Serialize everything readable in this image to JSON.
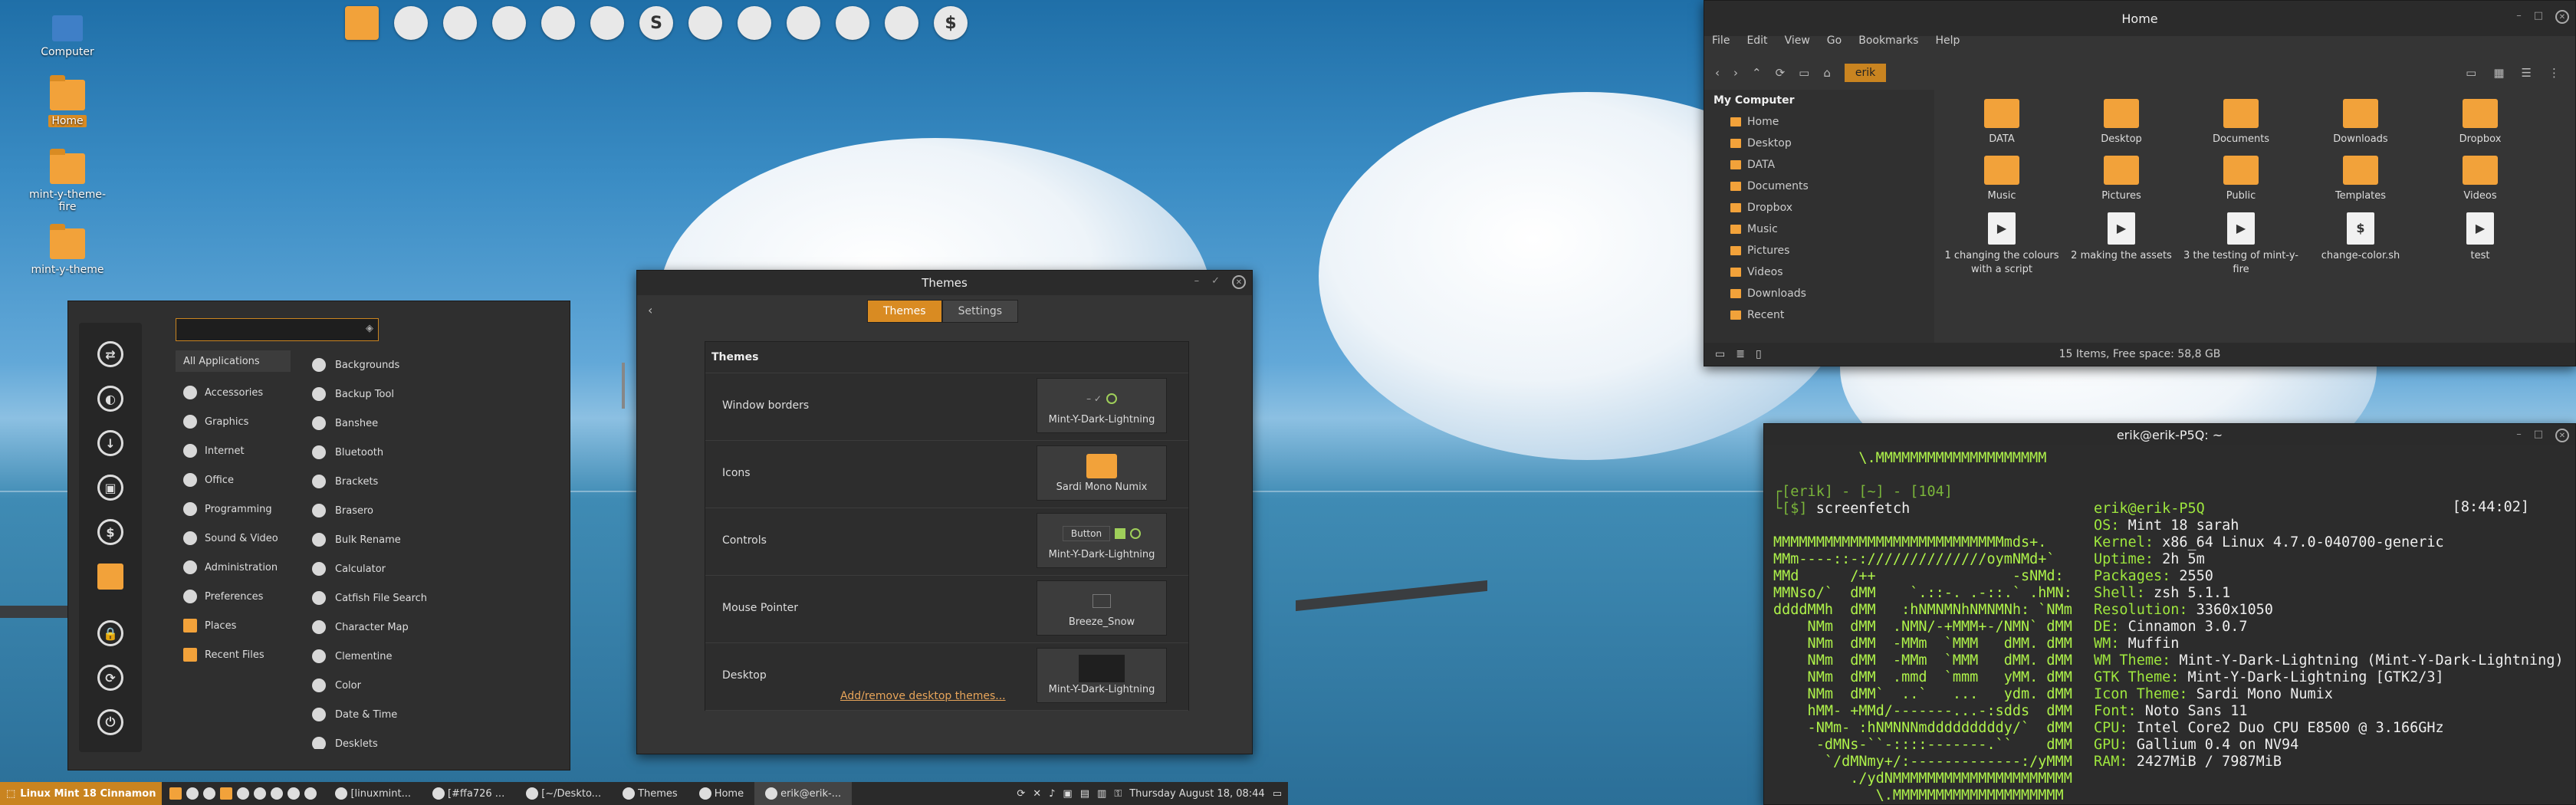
{
  "desktop": {
    "icons": [
      {
        "label": "Computer",
        "icon": "computer-icon"
      },
      {
        "label": "Home",
        "icon": "folder-home-icon"
      },
      {
        "label": "mint-y-theme-fire",
        "icon": "folder-icon"
      },
      {
        "label": "mint-y-theme",
        "icon": "folder-icon"
      }
    ],
    "top_launchers": [
      "folder",
      "redshift",
      "files",
      "spotify",
      "teapot",
      "weather",
      "S",
      "settings",
      "ninja",
      "brackets",
      "photos",
      "switch",
      "$"
    ]
  },
  "menu": {
    "search_placeholder": "",
    "categories": [
      "All Applications",
      "Accessories",
      "Graphics",
      "Internet",
      "Office",
      "Programming",
      "Sound & Video",
      "Administration",
      "Preferences",
      "Places",
      "Recent Files"
    ],
    "apps": [
      "Backgrounds",
      "Backup Tool",
      "Banshee",
      "Bluetooth",
      "Brackets",
      "Brasero",
      "Bulk Rename",
      "Calculator",
      "Catfish File Search",
      "Character Map",
      "Clementine",
      "Color",
      "Date & Time",
      "Desklets"
    ]
  },
  "themes_window": {
    "title": "Themes",
    "tabs": [
      "Themes",
      "Settings"
    ],
    "section": "Themes",
    "rows": [
      {
        "label": "Window borders",
        "value": "Mint-Y-Dark-Lightning"
      },
      {
        "label": "Icons",
        "value": "Sardi Mono Numix"
      },
      {
        "label": "Controls",
        "value": "Mint-Y-Dark-Lightning",
        "preview_button": "Button"
      },
      {
        "label": "Mouse Pointer",
        "value": "Breeze_Snow"
      },
      {
        "label": "Desktop",
        "value": "Mint-Y-Dark-Lightning"
      }
    ],
    "link": "Add/remove desktop themes..."
  },
  "file_manager": {
    "title": "Home",
    "menus": [
      "File",
      "Edit",
      "View",
      "Go",
      "Bookmarks",
      "Help"
    ],
    "crumb": "erik",
    "side_header": "My Computer",
    "side": [
      "Home",
      "Desktop",
      "DATA",
      "Documents",
      "Dropbox",
      "Music",
      "Pictures",
      "Videos",
      "Downloads",
      "Recent"
    ],
    "items": [
      {
        "label": "DATA",
        "kind": "folder"
      },
      {
        "label": "Desktop",
        "kind": "folder"
      },
      {
        "label": "Documents",
        "kind": "folder"
      },
      {
        "label": "Downloads",
        "kind": "folder"
      },
      {
        "label": "Dropbox",
        "kind": "folder"
      },
      {
        "label": "Music",
        "kind": "folder"
      },
      {
        "label": "Pictures",
        "kind": "folder"
      },
      {
        "label": "Public",
        "kind": "folder"
      },
      {
        "label": "Templates",
        "kind": "folder"
      },
      {
        "label": "Videos",
        "kind": "folder"
      },
      {
        "label": "1 changing the colours with a script",
        "kind": "file"
      },
      {
        "label": "2 making the assets",
        "kind": "file"
      },
      {
        "label": "3 the testing of mint-y-fire",
        "kind": "file"
      },
      {
        "label": "change-color.sh",
        "kind": "script"
      },
      {
        "label": "test",
        "kind": "file"
      }
    ],
    "status": "15 Items, Free space: 58,8 GB"
  },
  "terminal": {
    "title": "erik@erik-P5Q: ~",
    "prompt_user": "erik",
    "prompt_rest": "- [~] - [104]",
    "command": "screenfetch",
    "clock": "[8:44:02]",
    "userhost": "erik@erik-P5Q",
    "info": [
      {
        "k": "OS:",
        "v": "Mint 18 sarah"
      },
      {
        "k": "Kernel:",
        "v": "x86_64 Linux 4.7.0-040700-generic"
      },
      {
        "k": "Uptime:",
        "v": "2h 5m"
      },
      {
        "k": "Packages:",
        "v": "2550"
      },
      {
        "k": "Shell:",
        "v": "zsh 5.1.1"
      },
      {
        "k": "Resolution:",
        "v": "3360x1050"
      },
      {
        "k": "DE:",
        "v": "Cinnamon 3.0.7"
      },
      {
        "k": "WM:",
        "v": "Muffin"
      },
      {
        "k": "WM Theme:",
        "v": "Mint-Y-Dark-Lightning (Mint-Y-Dark-Lightning)"
      },
      {
        "k": "GTK Theme:",
        "v": "Mint-Y-Dark-Lightning [GTK2/3]"
      },
      {
        "k": "Icon Theme:",
        "v": "Sardi Mono Numix"
      },
      {
        "k": "Font:",
        "v": "Noto Sans 11"
      },
      {
        "k": "CPU:",
        "v": "Intel Core2 Duo CPU E8500 @ 3.166GHz"
      },
      {
        "k": "GPU:",
        "v": "Gallium 0.4 on NV94"
      },
      {
        "k": "RAM:",
        "v": "2427MiB / 7987MiB"
      }
    ]
  },
  "panel": {
    "menu_label": "Linux Mint 18 Cinnamon",
    "windows": [
      "[linuxmint...",
      "[#ffa726 ...",
      "[~/Deskto...",
      "Themes",
      "Home",
      "erik@erik-..."
    ],
    "clock": "Thursday August 18, 08:44"
  }
}
